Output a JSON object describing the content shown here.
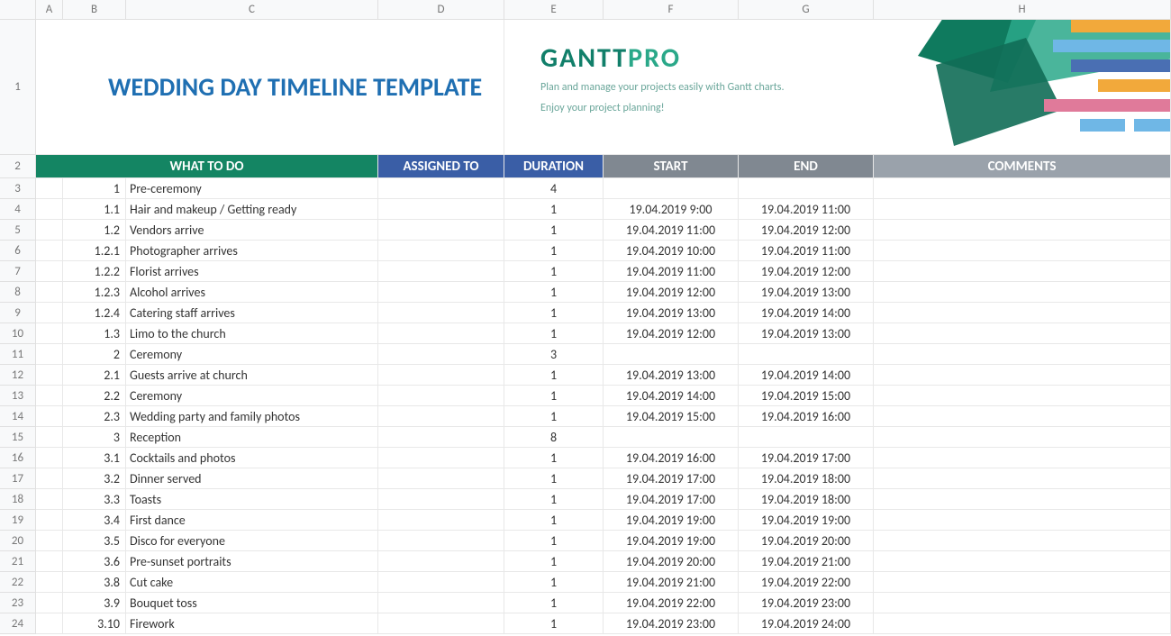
{
  "columns": [
    "A",
    "B",
    "C",
    "D",
    "E",
    "F",
    "G",
    "H"
  ],
  "rowNumbers": [
    1,
    2,
    3,
    4,
    5,
    6,
    7,
    8,
    9,
    10,
    11,
    12,
    13,
    14,
    15,
    16,
    17,
    18,
    19,
    20,
    21,
    22,
    23,
    24
  ],
  "title": "WEDDING DAY TIMELINE TEMPLATE",
  "brand": {
    "part1": "GANTT",
    "part2": "PRO"
  },
  "tagline1": "Plan and manage your projects easily with Gantt charts.",
  "tagline2": "Enjoy your project planning!",
  "headers": {
    "what": "WHAT TO DO",
    "assign": "ASSIGNED TO",
    "dur": "DURATION",
    "start": "START",
    "end": "END",
    "comm": "COMMENTS"
  },
  "rows": [
    {
      "id": "1",
      "task": "Pre-ceremony",
      "assigned": "",
      "dur": "4",
      "start": "",
      "end": "",
      "comm": ""
    },
    {
      "id": "1.1",
      "task": "Hair and makeup / Getting ready",
      "assigned": "",
      "dur": "1",
      "start": "19.04.2019 9:00",
      "end": "19.04.2019 11:00",
      "comm": ""
    },
    {
      "id": "1.2",
      "task": "Vendors arrive",
      "assigned": "",
      "dur": "1",
      "start": "19.04.2019 11:00",
      "end": "19.04.2019 12:00",
      "comm": ""
    },
    {
      "id": "1.2.1",
      "task": "Photographer arrives",
      "assigned": "",
      "dur": "1",
      "start": "19.04.2019 10:00",
      "end": "19.04.2019 11:00",
      "comm": ""
    },
    {
      "id": "1.2.2",
      "task": "Florist arrives",
      "assigned": "",
      "dur": "1",
      "start": "19.04.2019 11:00",
      "end": "19.04.2019 12:00",
      "comm": ""
    },
    {
      "id": "1.2.3",
      "task": "Alcohol arrives",
      "assigned": "",
      "dur": "1",
      "start": "19.04.2019 12:00",
      "end": "19.04.2019 13:00",
      "comm": ""
    },
    {
      "id": "1.2.4",
      "task": "Catering staff arrives",
      "assigned": "",
      "dur": "1",
      "start": "19.04.2019 13:00",
      "end": "19.04.2019 14:00",
      "comm": ""
    },
    {
      "id": "1.3",
      "task": "Limo to the church",
      "assigned": "",
      "dur": "1",
      "start": "19.04.2019 12:00",
      "end": "19.04.2019 13:00",
      "comm": ""
    },
    {
      "id": "2",
      "task": "Ceremony",
      "assigned": "",
      "dur": "3",
      "start": "",
      "end": "",
      "comm": ""
    },
    {
      "id": "2.1",
      "task": "Guests arrive at church",
      "assigned": "",
      "dur": "1",
      "start": "19.04.2019 13:00",
      "end": "19.04.2019 14:00",
      "comm": ""
    },
    {
      "id": "2.2",
      "task": "Ceremony",
      "assigned": "",
      "dur": "1",
      "start": "19.04.2019 14:00",
      "end": "19.04.2019 15:00",
      "comm": ""
    },
    {
      "id": "2.3",
      "task": "Wedding party and family photos",
      "assigned": "",
      "dur": "1",
      "start": "19.04.2019 15:00",
      "end": "19.04.2019 16:00",
      "comm": ""
    },
    {
      "id": "3",
      "task": "Reception",
      "assigned": "",
      "dur": "8",
      "start": "",
      "end": "",
      "comm": ""
    },
    {
      "id": "3.1",
      "task": "Cocktails and photos",
      "assigned": "",
      "dur": "1",
      "start": "19.04.2019 16:00",
      "end": "19.04.2019 17:00",
      "comm": ""
    },
    {
      "id": "3.2",
      "task": "Dinner served",
      "assigned": "",
      "dur": "1",
      "start": "19.04.2019 17:00",
      "end": "19.04.2019 18:00",
      "comm": ""
    },
    {
      "id": "3.3",
      "task": "Toasts",
      "assigned": "",
      "dur": "1",
      "start": "19.04.2019 17:00",
      "end": "19.04.2019 18:00",
      "comm": ""
    },
    {
      "id": "3.4",
      "task": "First dance",
      "assigned": "",
      "dur": "1",
      "start": "19.04.2019 19:00",
      "end": "19.04.2019 19:00",
      "comm": ""
    },
    {
      "id": "3.5",
      "task": "Disco for everyone",
      "assigned": "",
      "dur": "1",
      "start": "19.04.2019 19:00",
      "end": "19.04.2019 20:00",
      "comm": ""
    },
    {
      "id": "3.6",
      "task": "Pre-sunset portraits",
      "assigned": "",
      "dur": "1",
      "start": "19.04.2019 20:00",
      "end": "19.04.2019 21:00",
      "comm": ""
    },
    {
      "id": "3.8",
      "task": "Cut cake",
      "assigned": "",
      "dur": "1",
      "start": "19.04.2019 21:00",
      "end": "19.04.2019 22:00",
      "comm": ""
    },
    {
      "id": "3.9",
      "task": "Bouquet toss",
      "assigned": "",
      "dur": "1",
      "start": "19.04.2019 22:00",
      "end": "19.04.2019 23:00",
      "comm": ""
    },
    {
      "id": "3.10",
      "task": "Firework",
      "assigned": "",
      "dur": "1",
      "start": "19.04.2019 23:00",
      "end": "19.04.2019 24:00",
      "comm": ""
    }
  ]
}
